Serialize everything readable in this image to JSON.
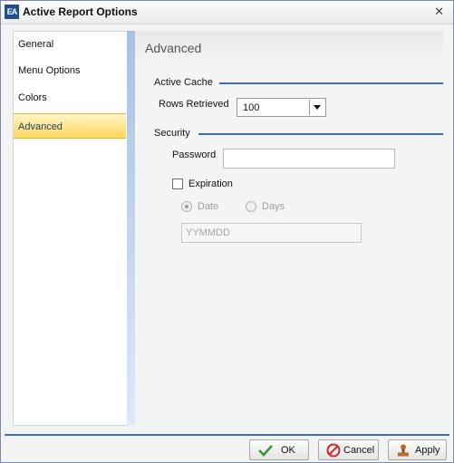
{
  "window": {
    "title": "Active Report Options",
    "icon": "app-logo-icon"
  },
  "nav": {
    "items": [
      {
        "label": "General",
        "active": false
      },
      {
        "label": "Menu Options",
        "active": false
      },
      {
        "label": "Colors",
        "active": false
      },
      {
        "label": "Advanced",
        "active": true
      }
    ]
  },
  "content": {
    "title": "Advanced",
    "active_cache": {
      "label": "Active Cache",
      "rows_label": "Rows Retrieved",
      "rows_value": "100"
    },
    "security": {
      "label": "Security",
      "password_label": "Password",
      "password_value": "",
      "expiration_label": "Expiration",
      "expiration_checked": false,
      "date_label": "Date",
      "days_label": "Days",
      "selected_mode": "Date",
      "date_placeholder": "YYMMDD"
    }
  },
  "buttons": {
    "ok": "OK",
    "cancel": "Cancel",
    "apply": "Apply"
  },
  "colors": {
    "accent": "#3a6cc8",
    "nav_active": "#ffd85a"
  }
}
